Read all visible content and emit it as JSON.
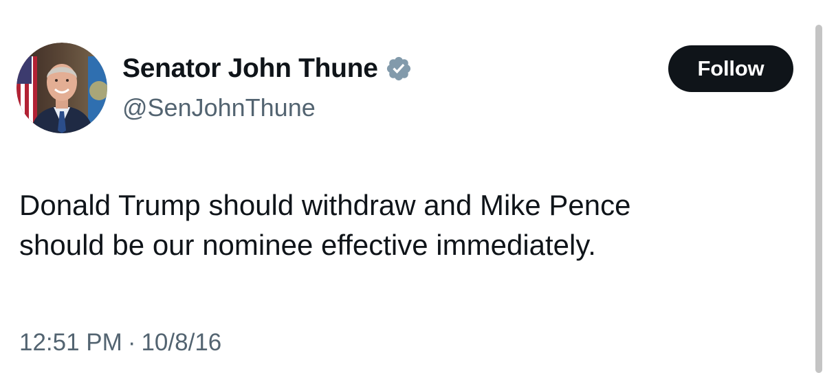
{
  "author": {
    "display_name": "Senator John Thune",
    "handle": "@SenJohnThune",
    "verified_badge_color": "#829aab",
    "avatar_icon": "profile-photo"
  },
  "actions": {
    "follow_label": "Follow"
  },
  "tweet": {
    "text": "Donald Trump should withdraw and Mike Pence\nshould be our nominee effective immediately.",
    "time": "12:51 PM",
    "separator": "·",
    "date": "10/8/16"
  },
  "colors": {
    "text_primary": "#0f1419",
    "text_secondary": "#536471",
    "follow_bg": "#0f1419",
    "follow_text": "#ffffff"
  }
}
